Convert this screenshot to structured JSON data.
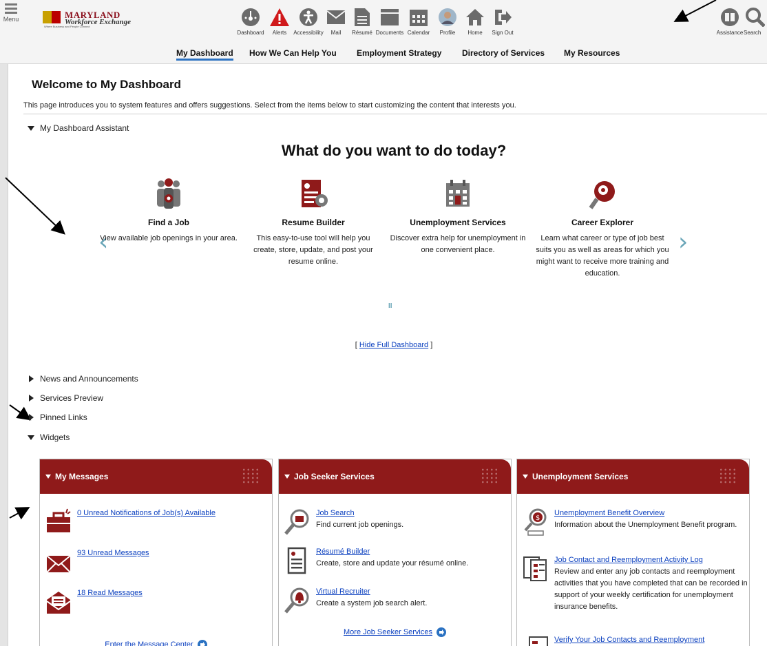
{
  "header": {
    "menu_label": "Menu",
    "logo": {
      "line1": "MARYLAND",
      "line2": "Workforce Exchange",
      "tagline": "Where Business and People Connect"
    },
    "nav": [
      {
        "label": "Dashboard",
        "icon": "dashboard-icon"
      },
      {
        "label": "Alerts",
        "icon": "alert-icon"
      },
      {
        "label": "Accessibility",
        "icon": "accessibility-icon"
      },
      {
        "label": "Mail",
        "icon": "mail-icon"
      },
      {
        "label": "Résumé",
        "icon": "resume-icon"
      },
      {
        "label": "Documents",
        "icon": "documents-icon"
      },
      {
        "label": "Calendar",
        "icon": "calendar-icon"
      },
      {
        "label": "Profile",
        "icon": "profile-icon"
      },
      {
        "label": "Home",
        "icon": "home-icon"
      },
      {
        "label": "Sign Out",
        "icon": "sign-out-icon"
      }
    ],
    "right_nav": [
      {
        "label": "Assistance",
        "icon": "book-icon"
      },
      {
        "label": "Search",
        "icon": "search-icon"
      }
    ],
    "subnav": [
      {
        "label": "My Dashboard",
        "active": true
      },
      {
        "label": "How We Can Help You",
        "active": false
      },
      {
        "label": "Employment Strategy",
        "active": false
      },
      {
        "label": "Directory of Services",
        "active": false
      },
      {
        "label": "My Resources",
        "active": false
      }
    ]
  },
  "page": {
    "title": "Welcome to My Dashboard",
    "intro": "This page introduces you to system features and offers suggestions. Select from the items below to start customizing the content that interests you.",
    "assistant_toggle": "My Dashboard Assistant",
    "question": "What do you want to do today?",
    "carousel": [
      {
        "title": "Find a Job",
        "desc": "View available job openings in your area.",
        "icon": "find-job-icon"
      },
      {
        "title": "Resume Builder",
        "desc": "This easy-to-use tool will help you create, store, update, and post your resume online.",
        "icon": "resume-builder-icon"
      },
      {
        "title": "Unemployment Services",
        "desc": "Discover extra help for unemployment in one convenient place.",
        "icon": "calendar-money-icon"
      },
      {
        "title": "Career Explorer",
        "desc": "Learn what career or type of job best suits you as well as areas for which you might want to receive more training and education.",
        "icon": "career-explorer-icon"
      }
    ],
    "pause_label": "II",
    "hide_dashboard": {
      "prefix": "[ ",
      "link": "Hide Full Dashboard",
      "suffix": " ]"
    },
    "sections": [
      {
        "label": "News and Announcements",
        "expanded": false
      },
      {
        "label": "Services Preview",
        "expanded": false
      },
      {
        "label": "Pinned Links",
        "expanded": false
      },
      {
        "label": "Widgets",
        "expanded": true
      }
    ]
  },
  "widgets": [
    {
      "title": "My Messages",
      "items": [
        {
          "link": "0 Unread Notifications of Job(s) Available",
          "desc": "",
          "icon": "briefcase-icon"
        },
        {
          "link": "93 Unread Messages",
          "desc": "",
          "icon": "envelope-icon"
        },
        {
          "link": "18 Read Messages",
          "desc": "",
          "icon": "open-envelope-icon"
        }
      ],
      "footer": "Enter the Message Center"
    },
    {
      "title": "Job Seeker Services",
      "items": [
        {
          "link": "Job Search",
          "desc": "Find current job openings.",
          "icon": "job-search-icon"
        },
        {
          "link": "Résumé Builder",
          "desc": "Create, store and update your résumé online.",
          "icon": "resume-doc-icon"
        },
        {
          "link": "Virtual Recruiter",
          "desc": "Create a system job search alert.",
          "icon": "bell-search-icon"
        }
      ],
      "footer": "More Job Seeker Services"
    },
    {
      "title": "Unemployment Services",
      "items": [
        {
          "link": "Unemployment Benefit Overview",
          "desc": "Information about the Unemployment Benefit program.",
          "icon": "benefit-search-icon"
        },
        {
          "link": "Job Contact and Reemployment Activity Log",
          "desc": "Review and enter any job contacts and reemployment activities that you have completed that can be recorded in support of your weekly certification for unemployment insurance benefits.",
          "icon": "activity-log-icon"
        },
        {
          "link": "Verify Your Job Contacts and Reemployment",
          "desc": "",
          "icon": "verify-icon"
        }
      ],
      "footer": ""
    }
  ],
  "colors": {
    "brand_red": "#8f1a1a",
    "link": "#0a3fbf",
    "accent": "#2b72c2",
    "chevron": "#6aa6b8"
  }
}
